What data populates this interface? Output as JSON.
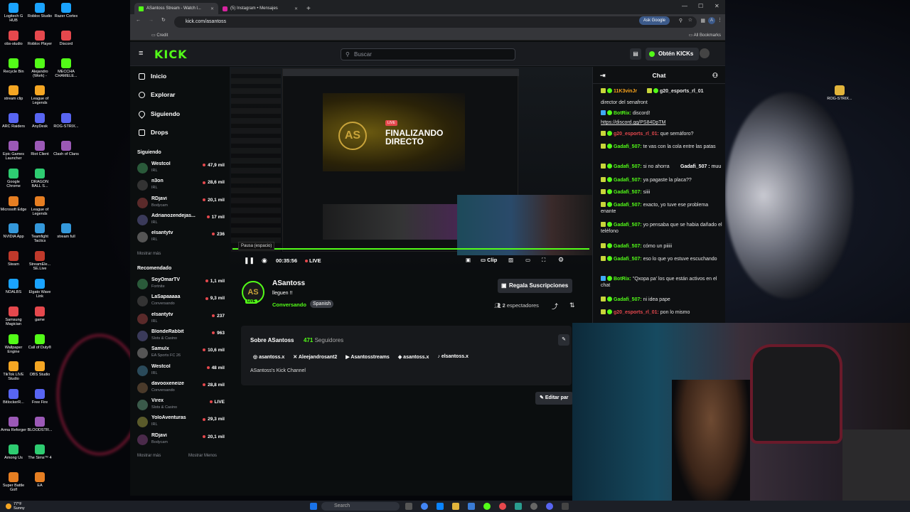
{
  "desktop": {
    "icons_col1": [
      "Logitech G HUB",
      "obs-studio",
      "Recycle Bin",
      "stream clip",
      "ARC Raiders",
      "Epic Games Launcher",
      "Google Chrome",
      "Microsoft Edge",
      "NVIDIA App",
      "Steam",
      "NOALBS",
      "Samsung Magician",
      "Wallpaper Engine",
      "TikTok LIVE Studio",
      "BitlockerR...",
      "Arma Reforger",
      "Among Us",
      "Super Battle Golf"
    ],
    "icons_col2": [
      "Roblox Studio",
      "Roblox Player",
      "Alejandro (Work) -",
      "League of Legends",
      "AnyDesk",
      "Riot Client",
      "DRAGON BALL S...",
      "League of Legends",
      "Teamfight Tactics",
      "StreamEle... SE.Live",
      "Elgato Wave Link",
      "game",
      "Call of Duty®",
      "OBS Studio",
      "Free Fire",
      "BLOODSTR...",
      "The Sims™ 4",
      "EA"
    ],
    "icons_col3": [
      "Razer Cortex",
      "Discord",
      "MECCHA CHAMELE...",
      "",
      "ROG-STRIX...",
      "Clash of Clans",
      "",
      "",
      "stream full"
    ],
    "right_icon": "ROG-STRIX..."
  },
  "taskbar": {
    "weather_temp": "77°F",
    "weather_desc": "Sunny",
    "search_placeholder": "Search"
  },
  "browser": {
    "tabs": [
      {
        "label": "ASantoss Stream - Watch l..."
      },
      {
        "label": "(5) Instagram • Mensajes"
      }
    ],
    "url": "kick.com/asantoss",
    "ask_google": "Ask Google",
    "bookmark": "Credit",
    "all_bookmarks": "All Bookmarks"
  },
  "kick": {
    "logo": "KICK",
    "search_placeholder": "Buscar",
    "obtener": "Obtén KICKs",
    "nav": [
      {
        "label": "Inicio"
      },
      {
        "label": "Explorar"
      },
      {
        "label": "Siguiendo"
      },
      {
        "label": "Drops"
      }
    ],
    "following_title": "Siguiendo",
    "following": [
      {
        "name": "Westcol",
        "game": "IRL",
        "viewers": "47,9 mil"
      },
      {
        "name": "n3on",
        "game": "IRL",
        "viewers": "28,6 mil"
      },
      {
        "name": "RDjavi",
        "game": "Bodycam",
        "viewers": "20,1 mil"
      },
      {
        "name": "Adrianozendejas...",
        "game": "IRL",
        "viewers": "17 mil"
      },
      {
        "name": "elsantytv",
        "game": "IRL",
        "viewers": "236"
      }
    ],
    "show_more_1": "Mostrar más",
    "recommended_title": "Recomendado",
    "recommended": [
      {
        "name": "SoyOmarTV",
        "game": "Fortnite",
        "viewers": "1,1 mil"
      },
      {
        "name": "LaSapaaaaa",
        "game": "Conversando",
        "viewers": "9,3 mil"
      },
      {
        "name": "elsantytv",
        "game": "IRL",
        "viewers": "237"
      },
      {
        "name": "BlondeRabbit",
        "game": "Slots & Casino",
        "viewers": "963"
      },
      {
        "name": "Samulx",
        "game": "EA Sports FC 26",
        "viewers": "10,6 mil"
      },
      {
        "name": "Westcol",
        "game": "IRL",
        "viewers": "48 mil"
      },
      {
        "name": "davooxeneize",
        "game": "Conversando",
        "viewers": "28,8 mil"
      },
      {
        "name": "Virex",
        "game": "Slots & Casino",
        "viewers": "LIVE"
      },
      {
        "name": "YoloAventuras",
        "game": "IRL",
        "viewers": "29,3 mil"
      },
      {
        "name": "RDjavi",
        "game": "Bodycam",
        "viewers": "20,1 mil"
      }
    ],
    "show_more_2": "Mostrar más",
    "show_less": "Mostrar Menos",
    "player": {
      "time": "00:35:56",
      "live": "LIVE",
      "clip": "Clip",
      "tooltip": "Pausa (espacio)",
      "inner_title": "FINALIZANDO DIRECTO",
      "inner_live": "LIVE"
    },
    "channel": {
      "name": "ASantoss",
      "title": "lleguen !!",
      "category": "Conversando",
      "tag": "Spanish",
      "subscribe": "Regala Suscripciones",
      "viewers_count": "2",
      "viewers_label": "espectadores",
      "live_badge": "LIVE",
      "avatar_text": "AS"
    },
    "about": {
      "title": "Sobre ASantoss",
      "followers_count": "471",
      "followers_label": "Seguidores",
      "socials": [
        "asantoss.x",
        "Aleejandrosant2",
        "Asantosstreams",
        "asantoss.x",
        "elsantoss.x"
      ],
      "description": "ASantoss's Kick Channel",
      "edit": "Editar par"
    },
    "chat": {
      "title": "Chat",
      "messages": [
        {
          "user": "11K3vinJr",
          "text": "",
          "color": "#f7a21b"
        },
        {
          "user": "g20_esports_rl_01",
          "text": "",
          "color": "#e6e6e6"
        },
        {
          "user": "",
          "text": "director del senafront",
          "color": "#e6e6e6"
        },
        {
          "user": "BotRix:",
          "text": "discord!",
          "color": "#53fc18"
        },
        {
          "user": "",
          "text": "https://discord.gg/PS84DpTM",
          "color": "#e6e6e6"
        },
        {
          "user": "g20_esports_rl_01:",
          "text": "que semáforo?",
          "color": "#e5484d"
        },
        {
          "user": "Gadafi_507:",
          "text": "te vas con la cola entre las patas",
          "color": "#53fc18"
        },
        {
          "user": "Gadafi_507:",
          "text": "si no ahorra",
          "color": "#53fc18"
        },
        {
          "user": "Gadafi_507:",
          "text": "ya pagaste la placa??",
          "color": "#53fc18"
        },
        {
          "user": "Gadafi_507:",
          "text": "siiii",
          "color": "#53fc18"
        },
        {
          "user": "Gadafi_507:",
          "text": "exacto, yo tuve ese problema enante",
          "color": "#53fc18"
        },
        {
          "user": "Gadafi_507:",
          "text": "yo pensaba que se habia dañado el teléfono",
          "color": "#53fc18"
        },
        {
          "user": "Gadafi_507:",
          "text": "cómo un piiiii",
          "color": "#53fc18"
        },
        {
          "user": "Gadafi_507:",
          "text": "eso lo que yo estuve escuchando",
          "color": "#53fc18"
        },
        {
          "user": "BotRix:",
          "text": "\"Qxopa pa' los que están activos en el chat",
          "color": "#53fc18"
        },
        {
          "user": "Gadafi_507:",
          "text": "ni idea pape",
          "color": "#53fc18"
        },
        {
          "user": "g20_esports_rl_01:",
          "text": "pon lo mismo",
          "color": "#e5484d"
        }
      ],
      "popup_user": "Gadafi_507 :",
      "popup_text": "muu"
    }
  }
}
